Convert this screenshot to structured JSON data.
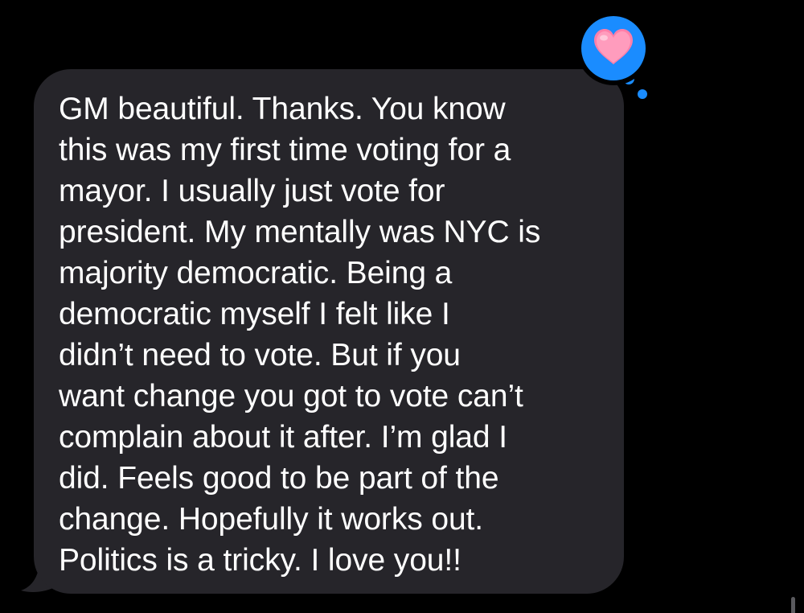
{
  "conversation": {
    "received_message": {
      "text": "GM beautiful. Thanks. You know\nthis was my first time voting for a\nmayor. I usually just vote for\npresident. My mentally was NYC is\nmajority democratic. Being a\ndemocratic myself I felt like I\ndidn’t need to vote. But if you\nwant change you got to vote can’t\ncomplain about it after. I’m glad I\ndid. Feels good to be part of the\nchange. Hopefully it works out.\nPolitics is a tricky. I love you!!",
      "tapback": {
        "reaction": "heart-icon",
        "color": "#ff7fa8",
        "badge_color": "#1a8cff"
      }
    },
    "colors": {
      "background": "#000000",
      "received_bubble": "#26252a",
      "text": "#ffffff"
    }
  }
}
